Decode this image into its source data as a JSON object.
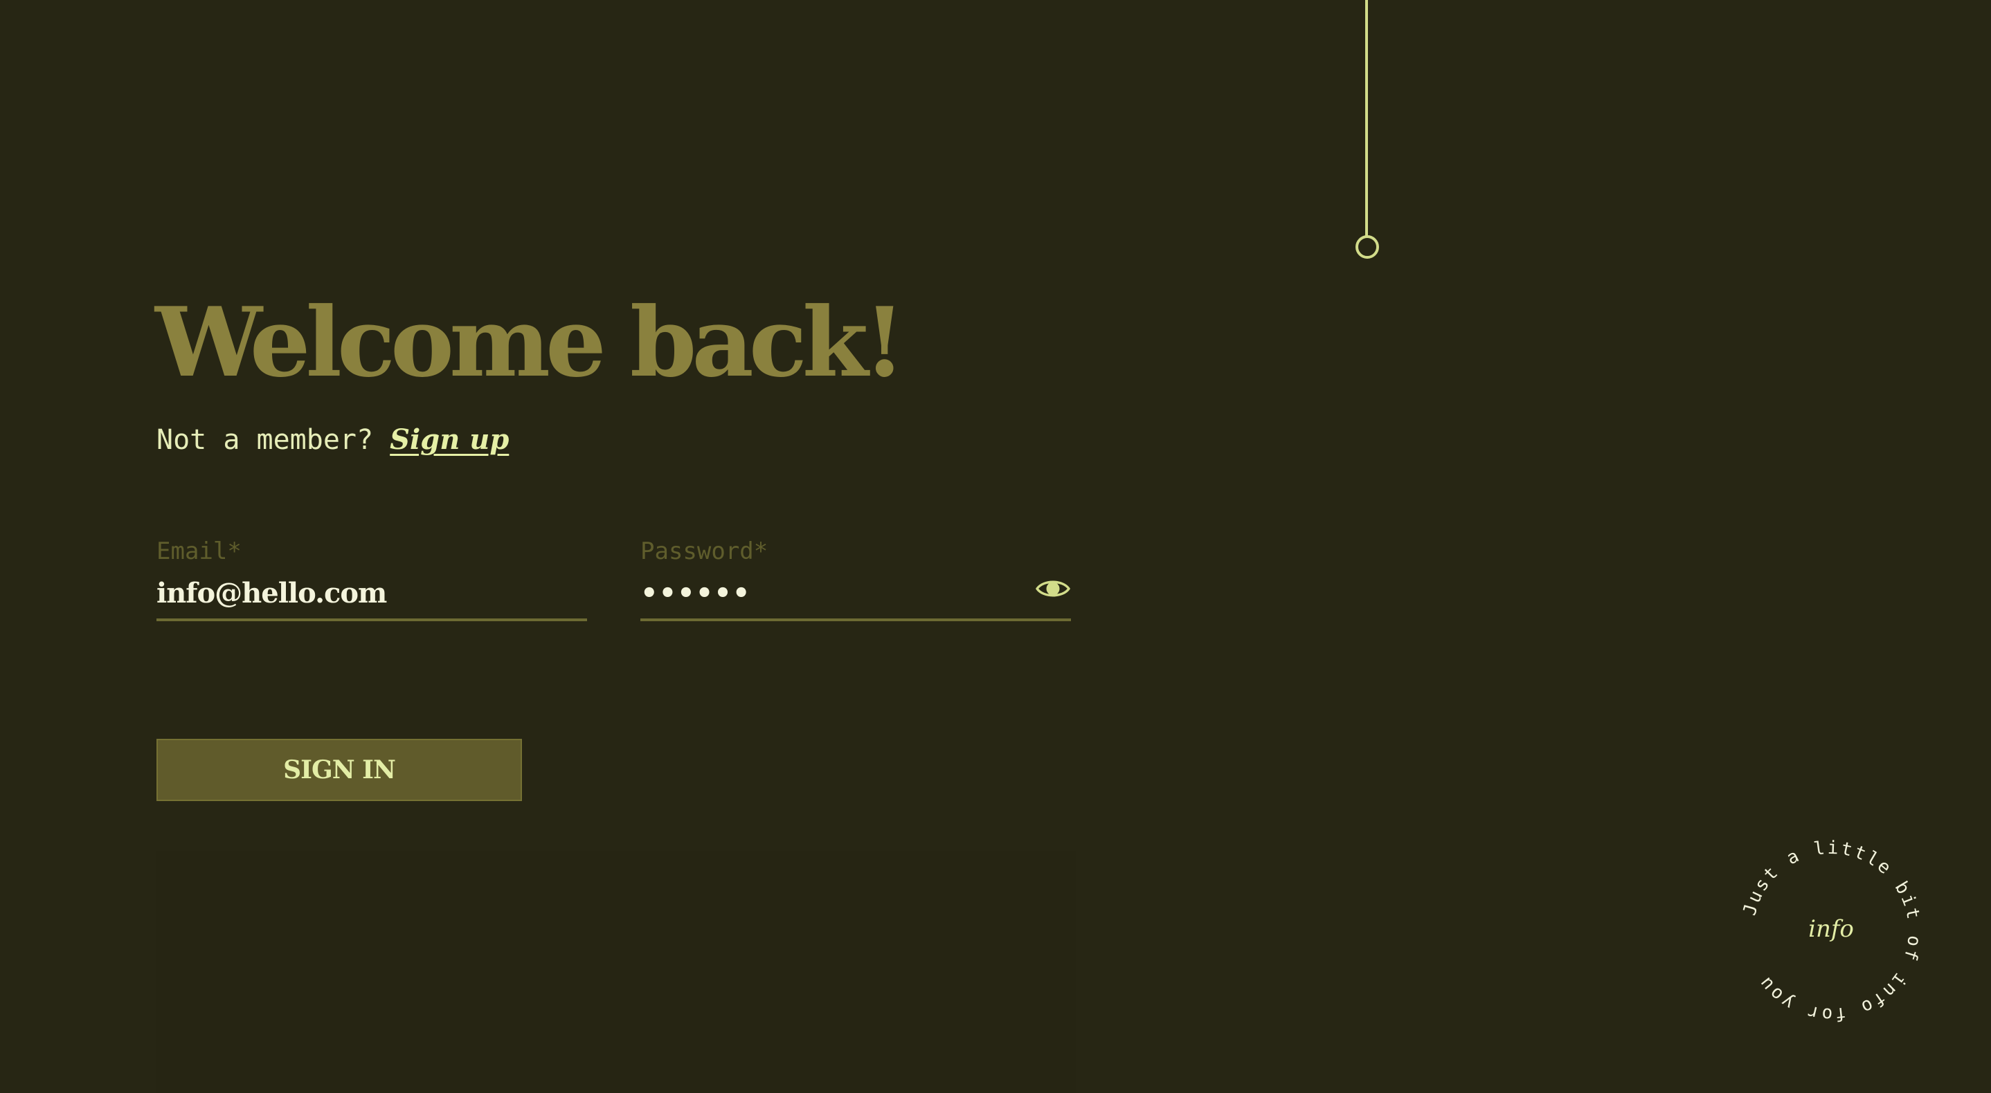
{
  "heading": {
    "title": "Welcome back!"
  },
  "member_prompt": {
    "text": "Not a member?",
    "link_label": "Sign up"
  },
  "form": {
    "email": {
      "label": "Email*",
      "value": "info@hello.com"
    },
    "password": {
      "label": "Password*",
      "value": "••••••",
      "toggle_icon": "eye-icon"
    },
    "submit_label": "SIGN IN"
  },
  "badge": {
    "ring_text": "Just a little bit of info for you",
    "center_text": "info"
  },
  "colors": {
    "background": "#272614",
    "title": "#8a813e",
    "accent": "#d2dc8a",
    "button": "#605b2b",
    "button_text": "#e3eda6",
    "label": "#5f5d2c",
    "input_text": "#f4f4dc"
  }
}
